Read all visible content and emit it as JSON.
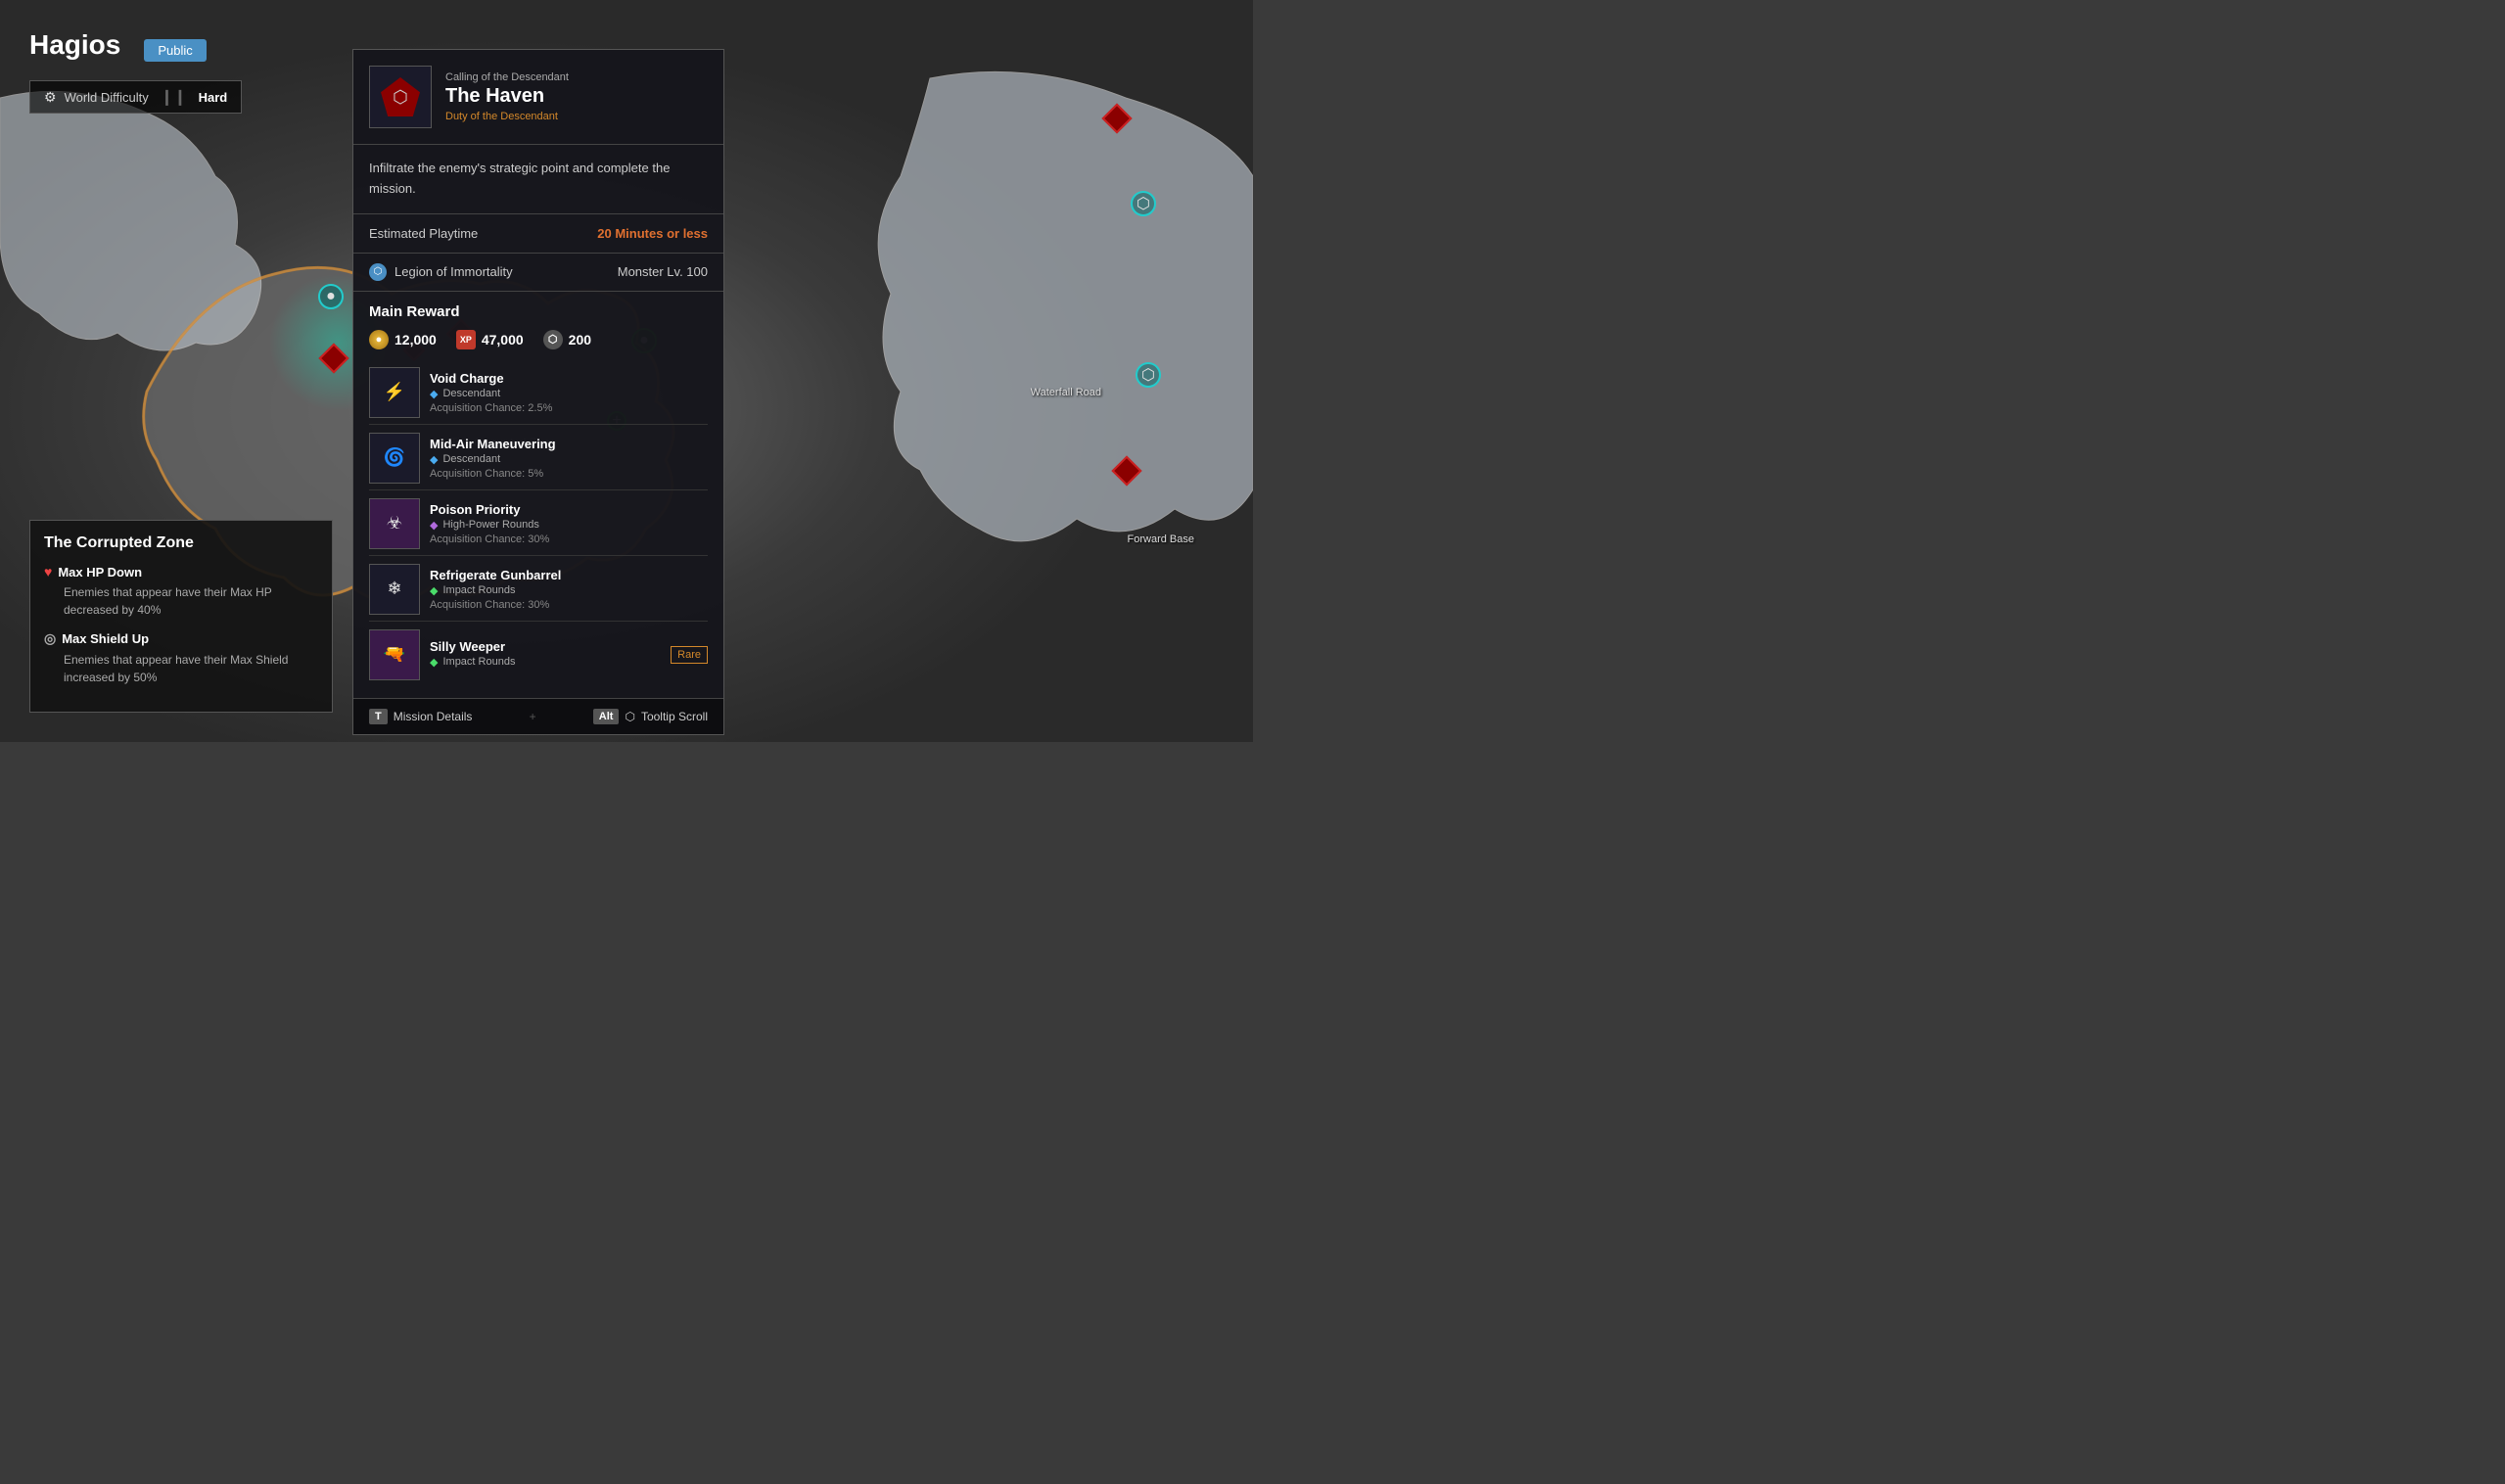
{
  "server": {
    "name": "Hagios",
    "visibility": "Public"
  },
  "difficulty": {
    "label": "World Difficulty",
    "value": "Hard",
    "icon": "⚙"
  },
  "zone": {
    "title": "The Corrupted Zone",
    "effects": [
      {
        "name": "Max HP Down",
        "icon": "♥",
        "type": "heart",
        "description": "Enemies that appear have their Max HP decreased by 40%"
      },
      {
        "name": "Max Shield Up",
        "icon": "◎",
        "type": "shield",
        "description": "Enemies that appear have their Max Shield increased by 50%"
      }
    ]
  },
  "mission": {
    "category": "Calling of the Descendant",
    "name": "The Haven",
    "subtitle": "Duty of the Descendant",
    "description": "Infiltrate the enemy's strategic point and complete the mission.",
    "playtime_label": "Estimated Playtime",
    "playtime_value": "20 Minutes or less",
    "faction": "Legion of Immortality",
    "monster_level": "Monster Lv. 100",
    "main_reward_title": "Main Reward",
    "currencies": [
      {
        "icon": "●",
        "type": "gold",
        "value": "12,000"
      },
      {
        "icon": "XP",
        "type": "xp",
        "value": "47,000"
      },
      {
        "icon": "⬡",
        "type": "shield",
        "value": "200"
      }
    ],
    "rewards": [
      {
        "name": "Void Charge",
        "type_icon": "◆",
        "type_color": "blue",
        "type_name": "Descendant",
        "chance": "Acquisition Chance: 2.5%",
        "rarity": "",
        "thumb_color": "dark"
      },
      {
        "name": "Mid-Air Maneuvering",
        "type_icon": "◆",
        "type_color": "blue",
        "type_name": "Descendant",
        "chance": "Acquisition Chance: 5%",
        "rarity": "",
        "thumb_color": "dark"
      },
      {
        "name": "Poison Priority",
        "type_icon": "◆",
        "type_color": "purple",
        "type_name": "High-Power Rounds",
        "chance": "Acquisition Chance: 30%",
        "rarity": "",
        "thumb_color": "purple"
      },
      {
        "name": "Refrigerate Gunbarrel",
        "type_icon": "◆",
        "type_color": "green",
        "type_name": "Impact Rounds",
        "chance": "Acquisition Chance: 30%",
        "rarity": "",
        "thumb_color": "dark"
      },
      {
        "name": "Silly Weeper",
        "type_icon": "◆",
        "type_color": "green",
        "type_name": "Impact Rounds",
        "chance": "",
        "rarity": "Rare",
        "thumb_color": "purple"
      }
    ],
    "footer": {
      "key1": "T",
      "action1": "Mission Details",
      "alt_key": "Alt",
      "key2": "⬡",
      "action2": "Tooltip Scroll"
    }
  }
}
